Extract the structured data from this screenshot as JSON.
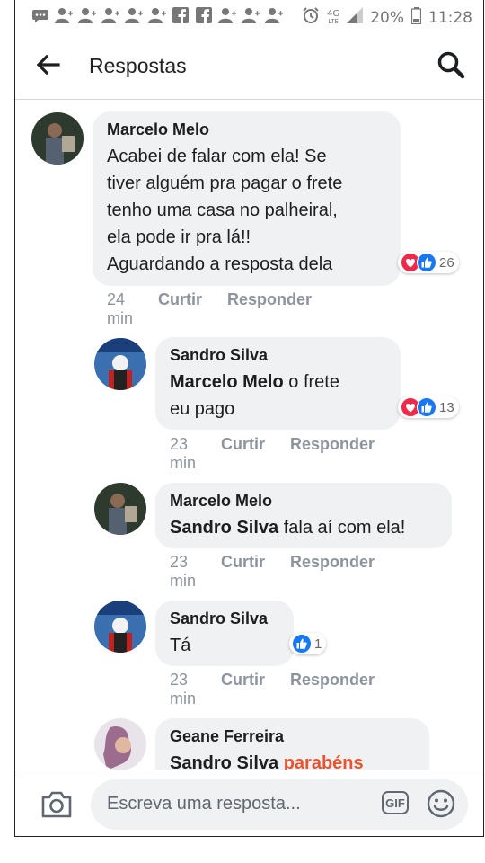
{
  "status_bar": {
    "network_label": "4G",
    "network_sub": "LTE",
    "battery": "20%",
    "time": "11:28"
  },
  "header": {
    "title": "Respostas"
  },
  "comments": [
    {
      "author": "Marcelo Melo",
      "lines": [
        "Acabei de falar com ela! Se",
        "tiver alguém pra pagar o frete",
        "tenho uma casa no palheiral,",
        "ela pode ir pra lá!!",
        "Aguardando a resposta dela"
      ],
      "reactions": [
        "love",
        "like"
      ],
      "reaction_count": "26",
      "time": "24 min",
      "like_label": "Curtir",
      "reply_label": "Responder"
    },
    {
      "author": "Sandro Silva",
      "mention": "Marcelo Melo",
      "line1_rest": " o frete",
      "line2": "eu pago",
      "reactions": [
        "love",
        "like"
      ],
      "reaction_count": "13",
      "time": "23 min",
      "like_label": "Curtir",
      "reply_label": "Responder"
    },
    {
      "author": "Marcelo Melo",
      "mention": "Sandro Silva",
      "rest": " fala aí com ela!",
      "time": "23 min",
      "like_label": "Curtir",
      "reply_label": "Responder"
    },
    {
      "author": "Sandro Silva",
      "text": "Tá",
      "reactions": [
        "like"
      ],
      "reaction_count": "1",
      "time": "23 min",
      "like_label": "Curtir",
      "reply_label": "Responder"
    },
    {
      "author": "Geane Ferreira",
      "mention": "Sandro Silva",
      "highlight": "parabéns"
    }
  ],
  "composer": {
    "placeholder": "Escreva uma resposta...",
    "gif_label": "GIF",
    "icons": [
      "camera-icon",
      "gif-icon",
      "emoji-icon"
    ]
  },
  "colors": {
    "like": "#1877f2",
    "love": "#f0284a",
    "highlight": "#e8542d",
    "bubble": "#f0f1f3"
  }
}
